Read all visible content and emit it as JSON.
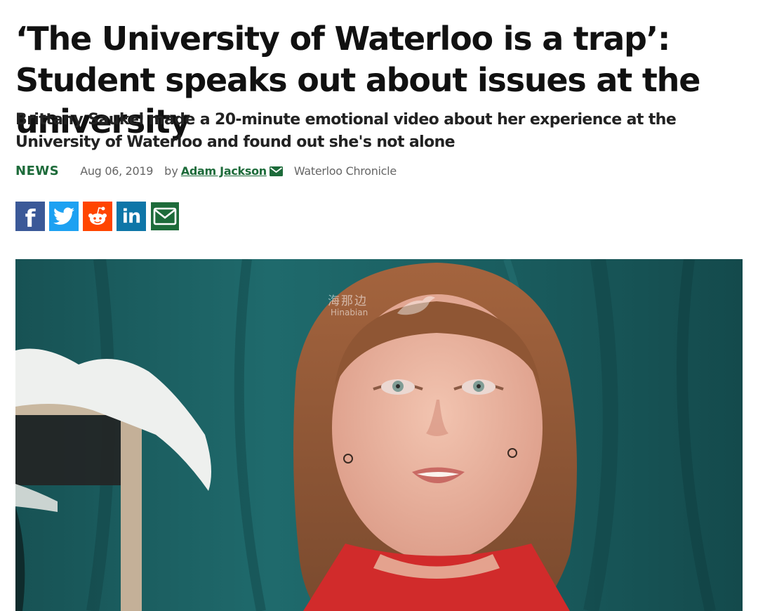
{
  "article": {
    "headline": "‘The University of Waterloo is a trap’: Student speaks out about issues at the university",
    "subhead": "Brittany Saukel made a 20-minute emotional video about her experience at the University of Waterloo and found out she's not alone",
    "category": "NEWS",
    "date": "Aug 06, 2019",
    "by_label": "by",
    "author": "Adam Jackson",
    "source": "Waterloo Chronicle"
  },
  "share": [
    {
      "name": "facebook",
      "glyph": "f",
      "color": "#3b5998",
      "icon": "facebook-icon"
    },
    {
      "name": "twitter",
      "glyph": "",
      "color": "#1da1f2",
      "icon": "twitter-icon"
    },
    {
      "name": "reddit",
      "glyph": "",
      "color": "#ff4500",
      "icon": "reddit-icon"
    },
    {
      "name": "linkedin",
      "glyph": "in",
      "color": "#0e76a8",
      "icon": "linkedin-icon"
    },
    {
      "name": "email",
      "glyph": "",
      "color": "#1d6b3a",
      "icon": "email-icon"
    }
  ],
  "photo": {
    "description_icon": "article-photo",
    "watermark_main": "海那边",
    "watermark_sub": "Hinabian"
  },
  "colors": {
    "accent_green": "#1d6b3a",
    "meta_gray": "#666666",
    "curtain_teal": "#1d5a5a"
  }
}
